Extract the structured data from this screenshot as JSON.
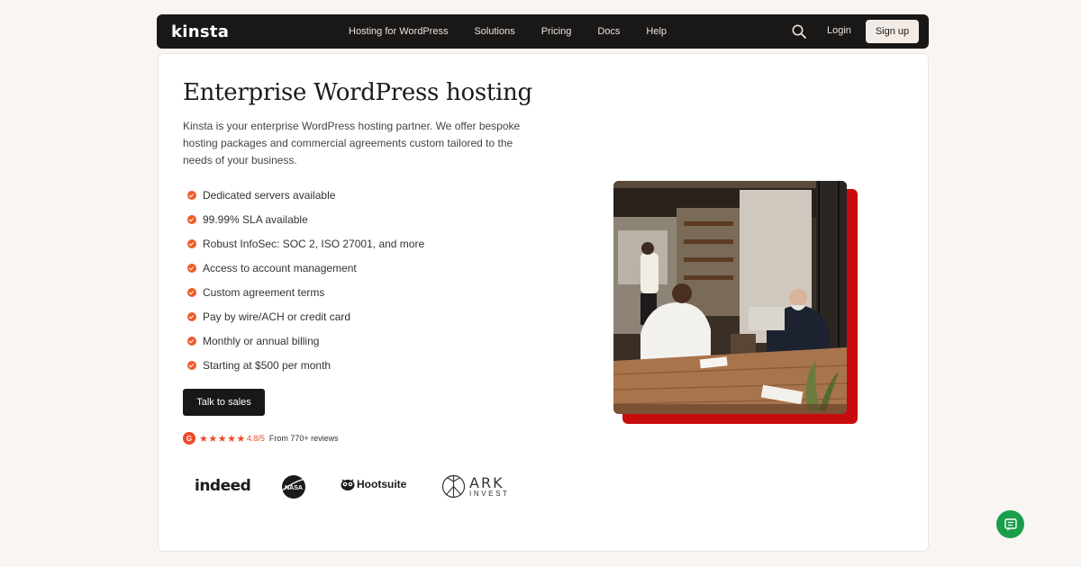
{
  "brand": {
    "logo_text": "kinsta"
  },
  "nav": {
    "links": [
      "Hosting for WordPress",
      "Solutions",
      "Pricing",
      "Docs",
      "Help"
    ],
    "login_label": "Login",
    "signup_label": "Sign up"
  },
  "hero": {
    "title": "Enterprise WordPress hosting",
    "intro": "Kinsta is your enterprise WordPress hosting partner. We offer bespoke hosting packages and commercial agreements custom tailored to the needs of your business.",
    "features": [
      "Dedicated servers available",
      "99.99% SLA available",
      "Robust InfoSec: SOC 2, ISO 27001, and more",
      "Access to account management",
      "Custom agreement terms",
      "Pay by wire/ACH or credit card",
      "Monthly or annual billing",
      "Starting at $500 per month"
    ],
    "cta_label": "Talk to sales"
  },
  "rating": {
    "badge": "G",
    "stars": "★★★★★",
    "score": "4.8/5",
    "reviews_text": "From 770+ reviews"
  },
  "client_logos": {
    "indeed": "indeed",
    "nasa": "NASA",
    "hootsuite": "Hootsuite",
    "ark_big": "ARK",
    "ark_small": "INVEST"
  },
  "colors": {
    "accent": "#ef5a2b",
    "nav_bg": "#1a1717",
    "photo_shadow": "#c80c0c",
    "chat": "#1b9e4b"
  },
  "icons": {
    "search": "search-icon",
    "check": "check-circle-icon",
    "chat": "chat-icon"
  }
}
